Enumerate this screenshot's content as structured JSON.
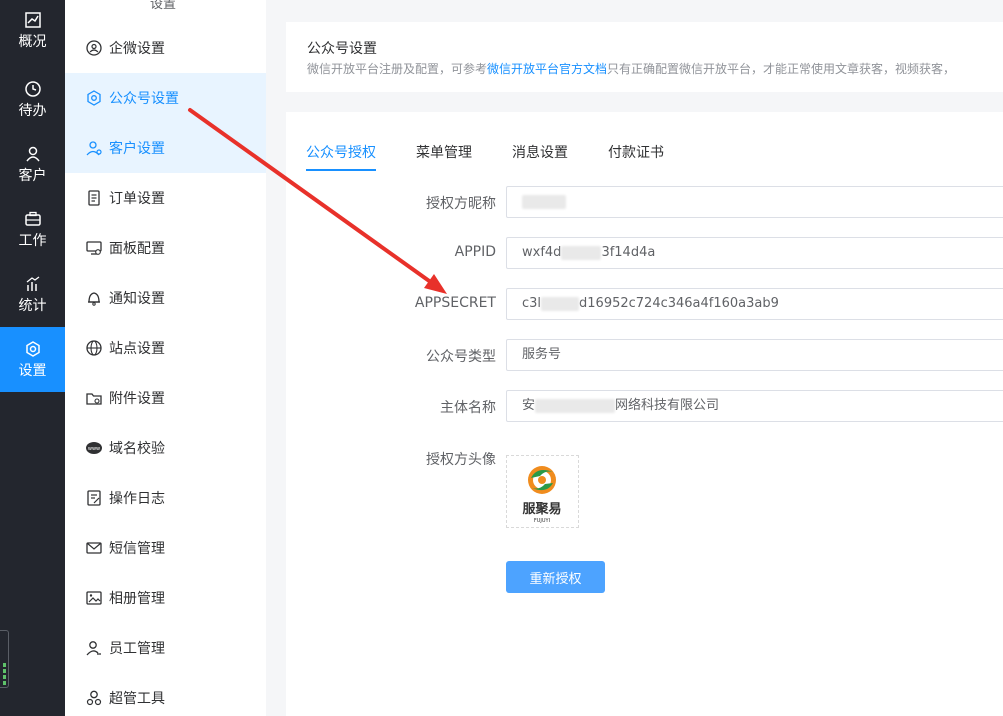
{
  "rail": {
    "items": [
      {
        "label": "概况",
        "icon": "chart-line-icon"
      },
      {
        "label": "待办",
        "icon": "clock-icon"
      },
      {
        "label": "客户",
        "icon": "user-icon"
      },
      {
        "label": "工作",
        "icon": "briefcase-icon"
      },
      {
        "label": "统计",
        "icon": "bar-chart-icon"
      },
      {
        "label": "设置",
        "icon": "settings-icon"
      }
    ],
    "active_color": "#1890ff"
  },
  "menu": {
    "top_label": "设置",
    "items": [
      {
        "label": "企微设置",
        "icon": "wecom-icon"
      },
      {
        "label": "公众号设置",
        "icon": "gear-icon"
      },
      {
        "label": "客户设置",
        "icon": "customer-icon"
      },
      {
        "label": "订单设置",
        "icon": "order-icon"
      },
      {
        "label": "面板配置",
        "icon": "monitor-icon"
      },
      {
        "label": "通知设置",
        "icon": "bell-icon"
      },
      {
        "label": "站点设置",
        "icon": "globe-icon"
      },
      {
        "label": "附件设置",
        "icon": "folder-icon"
      },
      {
        "label": "域名校验",
        "icon": "www-icon"
      },
      {
        "label": "操作日志",
        "icon": "log-icon"
      },
      {
        "label": "短信管理",
        "icon": "mail-icon"
      },
      {
        "label": "相册管理",
        "icon": "image-icon"
      },
      {
        "label": "员工管理",
        "icon": "staff-icon"
      },
      {
        "label": "超管工具",
        "icon": "admin-icon"
      }
    ]
  },
  "header": {
    "title": "公众号设置",
    "desc_before": "微信开放平台注册及配置，可参考",
    "desc_link": "微信开放平台官方文档",
    "desc_after": "只有正确配置微信开放平台，才能正常使用文章获客，视频获客，"
  },
  "tabs": [
    {
      "label": "公众号授权"
    },
    {
      "label": "菜单管理"
    },
    {
      "label": "消息设置"
    },
    {
      "label": "付款证书"
    }
  ],
  "form": {
    "nickname": {
      "label": "授权方昵称",
      "value": ""
    },
    "appid": {
      "label": "APPID",
      "value_start": "wxf4d",
      "value_end": "3f14d4a"
    },
    "appsecret": {
      "label": "APPSECRET",
      "value_start": "c3l",
      "value_end": "d16952c724c346a4f160a3ab9"
    },
    "account_type": {
      "label": "公众号类型",
      "value": "服务号"
    },
    "entity_name": {
      "label": "主体名称",
      "value_start": "安",
      "value_end": "网络科技有限公司"
    },
    "avatar": {
      "label": "授权方头像",
      "logo_text": "服聚易",
      "logo_sub": "FUJUYI"
    }
  },
  "reauth_button": {
    "label": "重新授权"
  }
}
